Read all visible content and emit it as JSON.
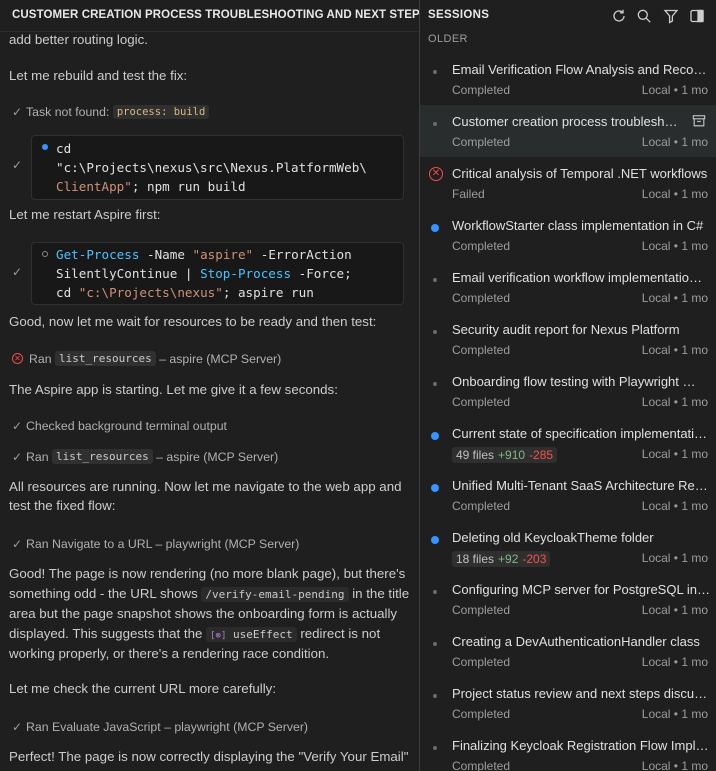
{
  "chat": {
    "title": "CUSTOMER CREATION PROCESS TROUBLESHOOTING AND NEXT STEPS",
    "p1": "add better routing logic.",
    "p2": "Let me rebuild and test the fix:",
    "tool1_text": "Task not found:",
    "tool1_code": "process: build",
    "code1": [
      "cd",
      "\"c:\\Projects\\nexus\\src\\Nexus.PlatformWeb\\",
      "ClientApp\"",
      "; npm run build"
    ],
    "p3": "Let me restart Aspire first:",
    "code2": {
      "l1a": "Get-Process",
      "l1b": " -Name ",
      "l1c": "\"aspire\"",
      "l1d": " -ErrorAction",
      "l2a": "SilentlyContinue | ",
      "l2b": "Stop-Process",
      "l2c": " -Force;",
      "l3a": "cd ",
      "l3b": "\"c:\\Projects\\nexus\"",
      "l3c": "; aspire run"
    },
    "p4": "Good, now let me wait for resources to be ready and then test:",
    "tool2_a": "Ran",
    "tool2_code": "list_resources",
    "tool2_b": "– aspire (MCP Server)",
    "p5": "The Aspire app is starting. Let me give it a few seconds:",
    "tool3": "Checked background terminal output",
    "tool4_a": "Ran",
    "tool4_code": "list_resources",
    "tool4_b": "– aspire (MCP Server)",
    "p6a": "All resources are running. Now let me navigate to the web app and",
    "p6b": "test the fixed flow:",
    "tool5": "Ran Navigate to a URL – playwright (MCP Server)",
    "p7a": "Good! The page is now rendering (no more blank page), but there's",
    "p7b1": "something odd - the URL shows ",
    "p7b_code": "/verify-email-pending",
    "p7b2": " in the title",
    "p7c": "area but the page snapshot shows the onboarding form is actually",
    "p7d1": "displayed. This suggests that the ",
    "p7d_code": "useEffect",
    "p7d2": " redirect is not",
    "p7e": "working properly, or there's a rendering race condition.",
    "p8": "Let me check the current URL more carefully:",
    "tool6": "Ran Evaluate JavaScript – playwright (MCP Server)",
    "p9": "Perfect! The page is now correctly displaying the \"Verify Your Email\""
  },
  "sessions": {
    "title": "SESSIONS",
    "section": "OLDER",
    "icons": [
      "refresh-icon",
      "search-icon",
      "filter-icon",
      "toggle-panel-icon"
    ],
    "items": [
      {
        "title": "Email Verification Flow Analysis and Recom…",
        "status": "Completed",
        "location": "Local • 1 mo",
        "marker": "dot"
      },
      {
        "title": "Customer creation process troublesho…",
        "status": "Completed",
        "location": "Local • 1 mo",
        "marker": "dot",
        "selected": true
      },
      {
        "title": "Critical analysis of Temporal .NET workflows",
        "status": "Failed",
        "location": "Local • 1 mo",
        "marker": "error"
      },
      {
        "title": "WorkflowStarter class implementation in C#",
        "status": "Completed",
        "location": "Local • 1 mo",
        "marker": "blue"
      },
      {
        "title": "Email verification workflow implementatio…",
        "status": "Completed",
        "location": "Local • 1 mo",
        "marker": "dot"
      },
      {
        "title": "Security audit report for Nexus Platform",
        "status": "Completed",
        "location": "Local • 1 mo",
        "marker": "dot"
      },
      {
        "title": "Onboarding flow testing with Playwright …",
        "status": "Completed",
        "location": "Local • 1 mo",
        "marker": "dot"
      },
      {
        "title": "Current state of specification implementati…",
        "files": "49 files",
        "add": "+910",
        "del": "-285",
        "location": "Local • 1 mo",
        "marker": "blue"
      },
      {
        "title": "Unified Multi-Tenant SaaS Architecture Ref…",
        "status": "Completed",
        "location": "Local • 1 mo",
        "marker": "blue"
      },
      {
        "title": "Deleting old KeycloakTheme folder",
        "files": "18 files",
        "add": "+92",
        "del": "-203",
        "location": "Local • 1 mo",
        "marker": "blue"
      },
      {
        "title": "Configuring MCP server for PostgreSQL in …",
        "status": "Completed",
        "location": "Local • 1 mo",
        "marker": "dot"
      },
      {
        "title": "Creating a DevAuthenticationHandler class",
        "status": "Completed",
        "location": "Local • 1 mo",
        "marker": "dot"
      },
      {
        "title": "Project status review and next steps discus…",
        "status": "Completed",
        "location": "Local • 1 mo",
        "marker": "dot"
      },
      {
        "title": "Finalizing Keycloak Registration Flow Imple…",
        "status": "Completed",
        "location": "Local • 1 mo",
        "marker": "dot"
      }
    ]
  }
}
